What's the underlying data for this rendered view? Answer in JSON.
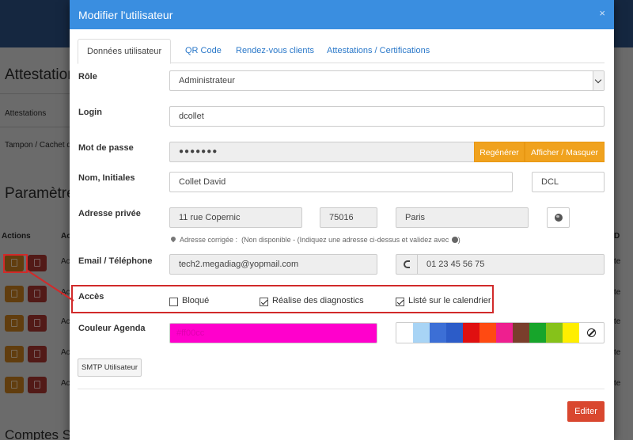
{
  "background": {
    "heading_attestations": "Attestation",
    "row_attestations": "Attestations",
    "row_tampon": "Tampon / Cachet d",
    "heading_parametres": "Paramètres",
    "col_actions": "Actions",
    "col_ac": "Ac",
    "row_ac": "Ac",
    "col_right": "D",
    "row_right": "te",
    "heading_comptes": "Comptes Spécifiques"
  },
  "modal": {
    "title": "Modifier l'utilisateur",
    "close": "×",
    "tabs": [
      {
        "label": "Données utilisateur",
        "active": true
      },
      {
        "label": "QR Code",
        "active": false
      },
      {
        "label": "Rendez-vous clients",
        "active": false
      },
      {
        "label": "Attestations / Certifications",
        "active": false
      }
    ],
    "role": {
      "label": "Rôle",
      "value": "Administrateur"
    },
    "login": {
      "label": "Login",
      "value": "dcollet"
    },
    "password": {
      "label": "Mot de passe",
      "value": "●●●●●●●",
      "regen_label": "Regénérer",
      "toggle_label": "Afficher / Masquer"
    },
    "name": {
      "label": "Nom, Initiales",
      "full_name": "Collet David",
      "initials": "DCL"
    },
    "address": {
      "label": "Adresse privée",
      "street": "11 rue Copernic",
      "postcode": "75016",
      "city": "Paris",
      "hint_prefix": "Adresse corrigée :",
      "hint_text": "(Non disponible - (Indiquez une adresse ci-dessus et validez avec"
    },
    "contact": {
      "label": "Email / Téléphone",
      "email": "tech2.megadiag@yopmail.com",
      "phone": "01 23 45 56 75"
    },
    "access": {
      "label": "Accès",
      "options": [
        {
          "label": "Bloqué",
          "checked": false
        },
        {
          "label": "Réalise des diagnostics",
          "checked": true
        },
        {
          "label": "Listé sur le calendrier",
          "checked": true
        }
      ]
    },
    "agenda_color": {
      "label": "Couleur Agenda",
      "value": "#ff00cc",
      "palette": [
        "#ffffff",
        "#a8d4f5",
        "#3c6fd6",
        "#2c5cc8",
        "#e01010",
        "#ff4a12",
        "#ee1f8f",
        "#7a3e2c",
        "#17a52b",
        "#86c21a",
        "#ffee00"
      ]
    },
    "smtp_label": "SMTP Utilisateur",
    "edit_label": "Editer"
  },
  "colors": {
    "header": "#3a8ee0",
    "orange": "#f0a21e",
    "edit": "#d9472f",
    "annotation": "#d12a2a"
  }
}
